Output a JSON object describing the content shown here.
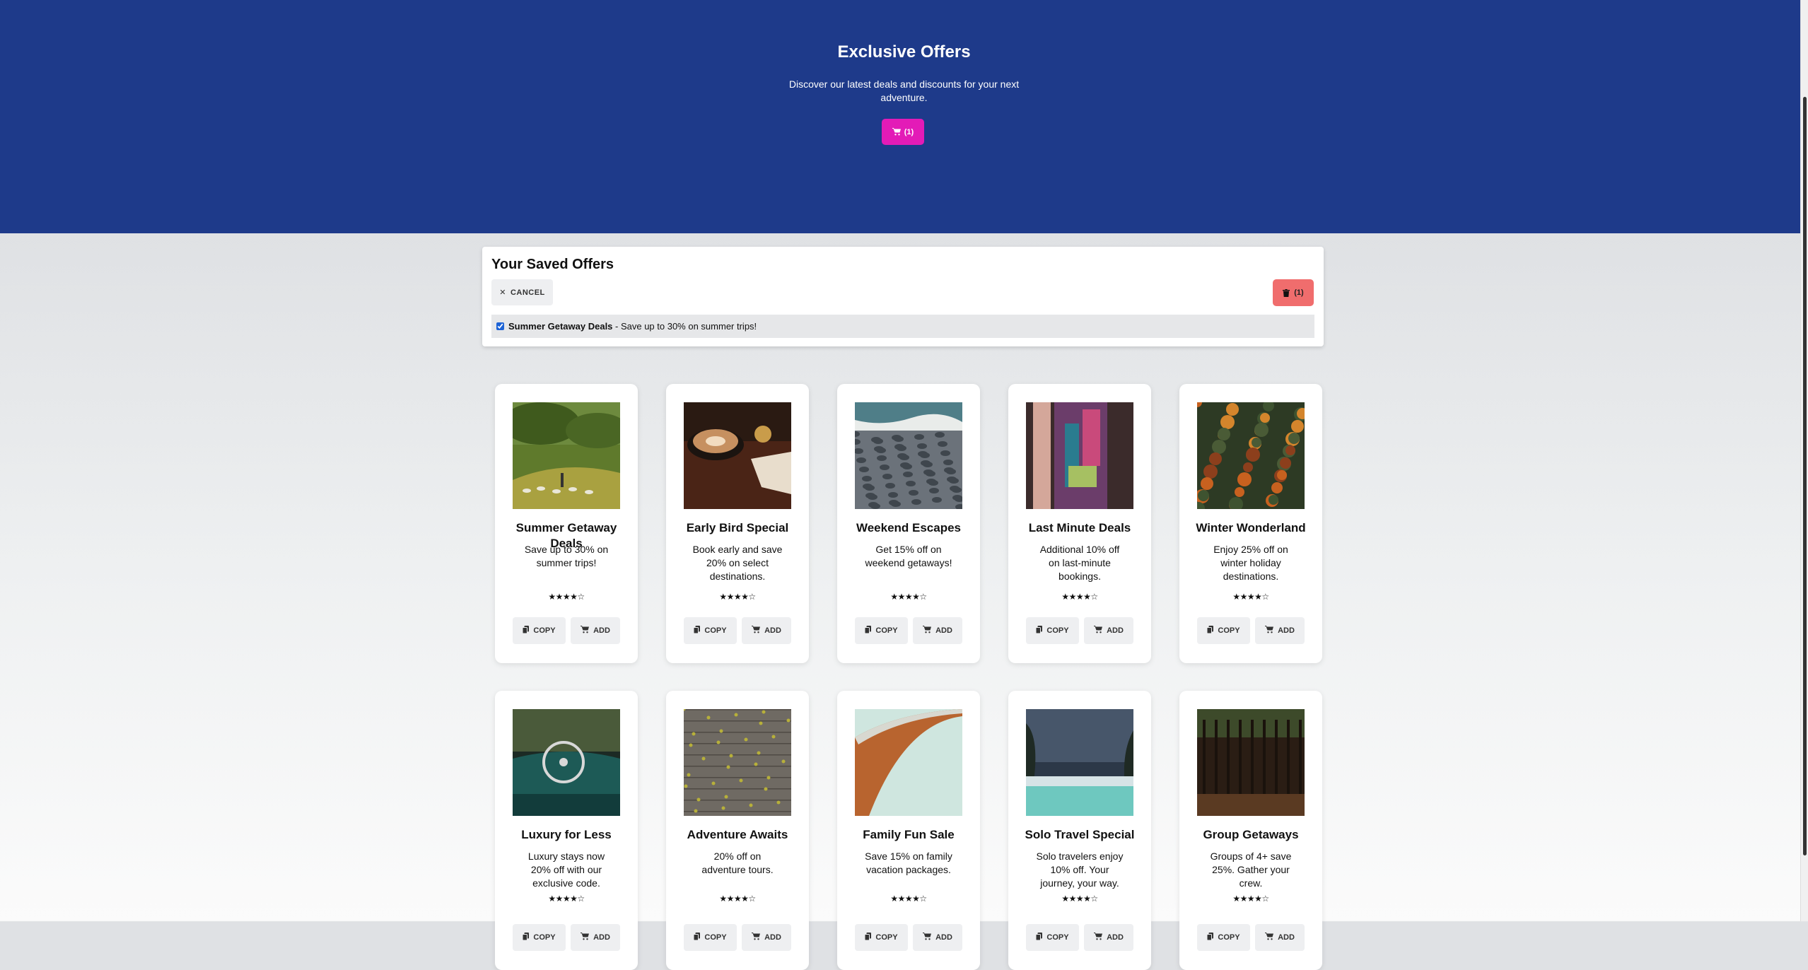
{
  "hero": {
    "title": "Exclusive Offers",
    "subtitle": "Discover our latest deals and discounts for your next adventure.",
    "cart_count": "(1)",
    "colors": {
      "background": "#1e3a8a",
      "cart_button": "#e31bb7"
    }
  },
  "saved": {
    "title": "Your Saved Offers",
    "cancel_label": "CANCEL",
    "delete_count": "(1)",
    "items": [
      {
        "title": "Summer Getaway Deals",
        "desc": " - Save up to 30% on summer trips!",
        "checked": true
      }
    ]
  },
  "offers": [
    {
      "title": "Summer Getaway Deals",
      "desc": "Save up to 30% on summer trips!",
      "rating": "★★★★☆",
      "copy": "COPY",
      "add": "ADD",
      "image": "green hills with sheep"
    },
    {
      "title": "Early Bird Special",
      "desc": "Book early and save 20% on select destinations.",
      "rating": "★★★★☆",
      "copy": "COPY",
      "add": "ADD",
      "image": "coffee cup on wooden table"
    },
    {
      "title": "Weekend Escapes",
      "desc": "Get 15% off on weekend getaways!",
      "rating": "★★★★☆",
      "copy": "COPY",
      "add": "ADD",
      "image": "pebble beach"
    },
    {
      "title": "Last Minute Deals",
      "desc": "Additional 10% off on last-minute bookings.",
      "rating": "★★★★☆",
      "copy": "COPY",
      "add": "ADD",
      "image": "colorful shawl"
    },
    {
      "title": "Winter Wonderland",
      "desc": "Enjoy 25% off on winter holiday destinations.",
      "rating": "★★★★☆",
      "copy": "COPY",
      "add": "ADD",
      "image": "aerial autumn forest"
    },
    {
      "title": "Luxury for Less",
      "desc": "Luxury stays now 20% off with our exclusive code.",
      "rating": "★★★★☆",
      "copy": "COPY",
      "add": "ADD",
      "image": "vintage car interior"
    },
    {
      "title": "Adventure Awaits",
      "desc": "20% off on adventure tours.",
      "rating": "★★★★☆",
      "copy": "COPY",
      "add": "ADD",
      "image": "wooden deck with leaves"
    },
    {
      "title": "Family Fun Sale",
      "desc": "Save 15% on family vacation packages.",
      "rating": "★★★★☆",
      "copy": "COPY",
      "add": "ADD",
      "image": "curved architecture"
    },
    {
      "title": "Solo Travel Special",
      "desc": "Solo travelers enjoy 10% off. Your journey, your way.",
      "rating": "★★★★☆",
      "copy": "COPY",
      "add": "ADD",
      "image": "turquoise sea and cliffs"
    },
    {
      "title": "Group Getaways",
      "desc": "Groups of 4+ save 25%. Gather your crew.",
      "rating": "★★★★☆",
      "copy": "COPY",
      "add": "ADD",
      "image": "dark forest trees"
    }
  ]
}
